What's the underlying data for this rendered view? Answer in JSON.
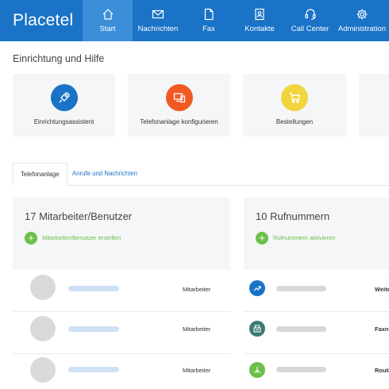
{
  "app": {
    "logo_text": "Placetel"
  },
  "nav": {
    "items": [
      {
        "label": "Start",
        "icon": "home-icon",
        "active": true
      },
      {
        "label": "Nachrichten",
        "icon": "envelope-icon"
      },
      {
        "label": "Fax",
        "icon": "document-icon"
      },
      {
        "label": "Kontakte",
        "icon": "contact-book-icon"
      },
      {
        "label": "Call Center",
        "icon": "headset-icon"
      },
      {
        "label": "Administration",
        "icon": "gear-icon"
      }
    ]
  },
  "setup": {
    "title": "Einrichtung und Hilfe",
    "cards": [
      {
        "label": "Einrichtungsassistent",
        "icon": "rocket-icon",
        "color": "#1a73c6"
      },
      {
        "label": "Telefonanlage konfigurieren",
        "icon": "devices-icon",
        "color": "#f05a22"
      },
      {
        "label": "Bestellungen",
        "icon": "cart-icon",
        "color": "#f2d53c"
      }
    ]
  },
  "tabs": [
    {
      "label": "Telefonanlage",
      "active": true
    },
    {
      "label": "Anrufe und Nachrichten",
      "active": false
    }
  ],
  "employees": {
    "title": "17 Mitarbeiter/Benutzer",
    "action": "Mitarbeiter/Benutzer erstellen",
    "rows": [
      {
        "role": "Mitarbeiter"
      },
      {
        "role": "Mitarbeiter"
      },
      {
        "role": "Mitarbeiter"
      }
    ]
  },
  "numbers": {
    "title": "10 Rufnummern",
    "action": "Rufnummern aktivieren",
    "rows": [
      {
        "type": "Weite",
        "icon": "forward-icon",
        "color": "#1a73c6"
      },
      {
        "type": "Faxn",
        "icon": "fax-icon",
        "color": "#3d7a74"
      },
      {
        "type": "Routi",
        "icon": "routing-icon",
        "color": "#6cc04a"
      }
    ]
  },
  "colors": {
    "brand": "#1a73c6",
    "nav_active": "#3b8fd9",
    "success": "#6cc04a",
    "panel_bg": "#f4f6f8"
  }
}
